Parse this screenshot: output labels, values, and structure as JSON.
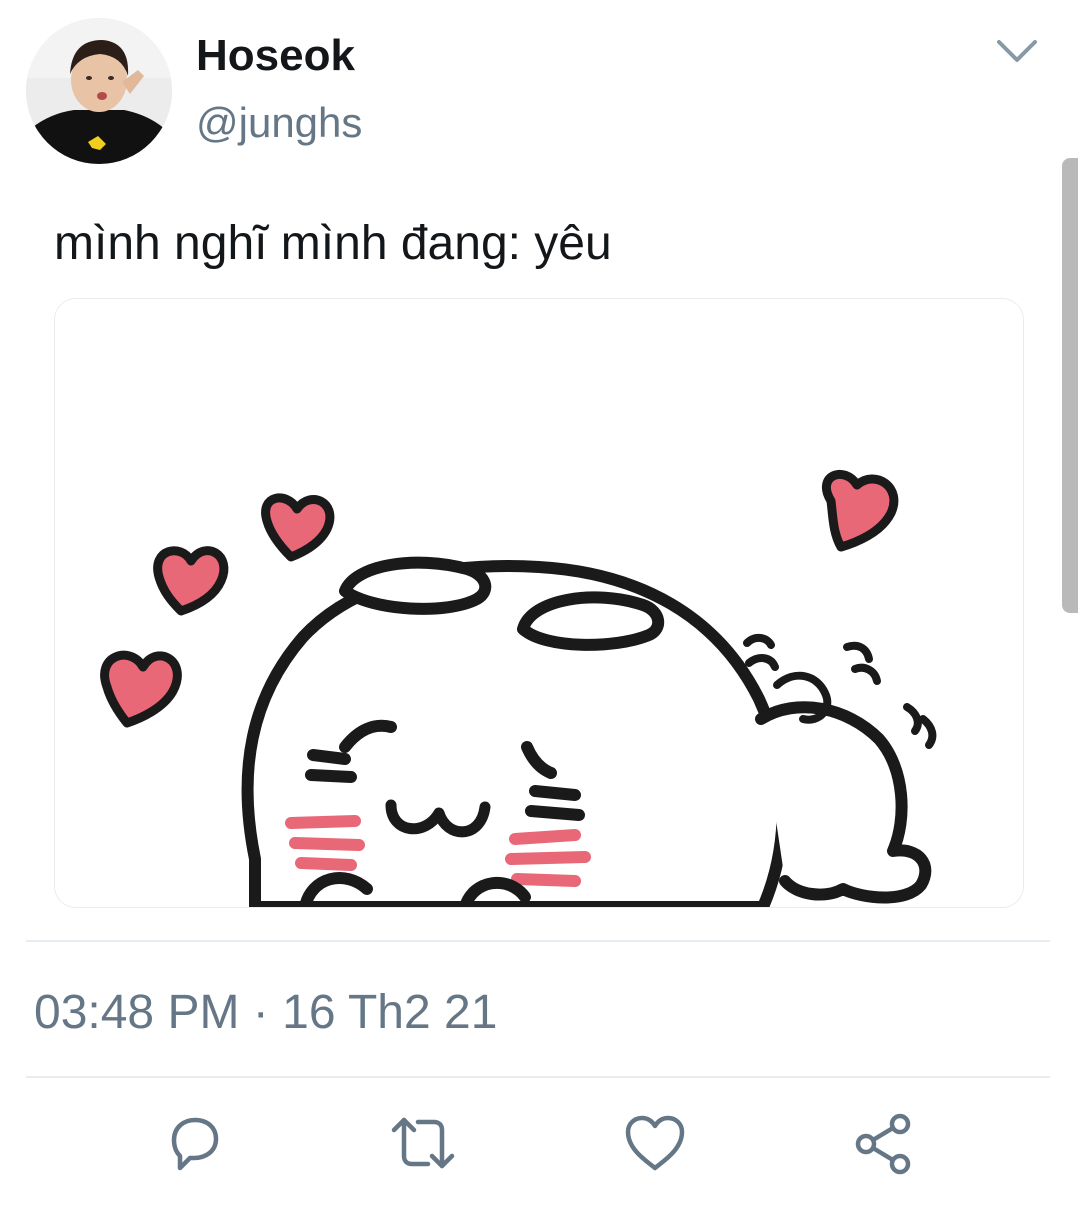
{
  "tweet": {
    "author": {
      "display_name": "Hoseok",
      "handle": "@junghs"
    },
    "text": "mình nghĩ mình đang: yêu",
    "timestamp": "03:48 PM",
    "date": "16 Th2 21",
    "separator": "·"
  },
  "icons": {
    "menu": "chevron-down-icon",
    "reply": "reply-icon",
    "retweet": "retweet-icon",
    "like": "heart-icon",
    "share": "share-icon"
  },
  "colors": {
    "secondary_text": "#657786",
    "icon": "#657786",
    "heart_pink": "#e86878"
  }
}
